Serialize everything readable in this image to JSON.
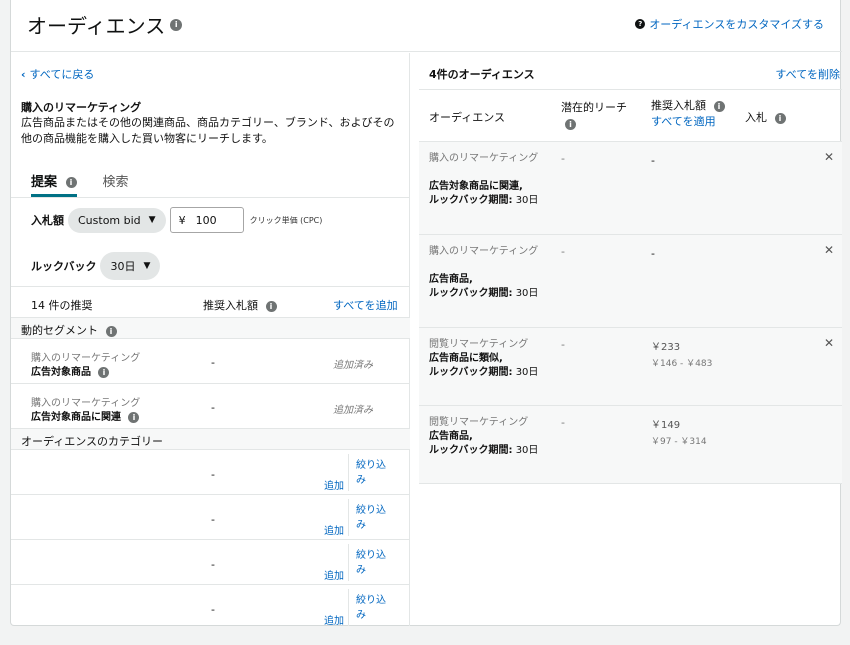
{
  "header": {
    "title": "オーディエンス",
    "customize": "オーディエンスをカスタマイズする"
  },
  "left": {
    "back": "すべてに戻る",
    "desc_title": "購入のリマーケティング",
    "desc_body": "広告商品またはその他の関連商品、商品カテゴリー、ブランド、およびその他の商品機能を購入した買い物客にリーチします。",
    "tabs": [
      {
        "label": "提案"
      },
      {
        "label": "検索"
      }
    ],
    "bid_label": "入札額",
    "bid_type": "Custom bid",
    "currency": "¥",
    "bid_value": "100",
    "cpc_label": "クリック単価 (CPC)",
    "lookback_label": "ルックバック",
    "lookback_value": "30日",
    "suggest_count": "14 件の推奨",
    "rec_bid": "推奨入札額",
    "add_all": "すべてを追加",
    "seg_dynamic": "動的セグメント",
    "rows": [
      {
        "line1": "購入のリマーケティング",
        "line2": "広告対象商品",
        "dash": "-",
        "status": "追加済み"
      },
      {
        "line1": "購入のリマーケティング",
        "line2": "広告対象商品に関連",
        "dash": "-",
        "status": "追加済み"
      }
    ],
    "seg_category": "オーディエンスのカテゴリー",
    "cat_rows": [
      {
        "dash": "-",
        "add": "追加",
        "narrow": "絞り込み"
      },
      {
        "dash": "-",
        "add": "追加",
        "narrow": "絞り込み"
      },
      {
        "dash": "-",
        "add": "追加",
        "narrow": "絞り込み"
      },
      {
        "dash": "-",
        "add": "追加",
        "narrow": "絞り込み"
      }
    ]
  },
  "right": {
    "count": "4件のオーディエンス",
    "delete_all": "すべてを削除",
    "col_audience": "オーディエンス",
    "col_reach": "潜在的リーチ",
    "col_rec_bid": "推奨入札額",
    "col_apply_all": "すべてを適用",
    "col_bid": "入札",
    "items": [
      {
        "name": "購入のリマーケティング",
        "bold": "広告対象商品に関連,",
        "look_label": "ルックバック期間:",
        "look_value": "30日",
        "reach": "-",
        "bid": "-",
        "range": ""
      },
      {
        "name": "購入のリマーケティング",
        "bold": "広告商品,",
        "look_label": "ルックバック期間:",
        "look_value": "30日",
        "reach": "-",
        "bid": "-",
        "range": ""
      },
      {
        "name": "閲覧リマーケティング",
        "bold": "広告商品に類似,",
        "look_label": "ルックバック期間:",
        "look_value": "30日",
        "reach": "-",
        "bid": "￥233",
        "range": "￥146 - ￥483"
      },
      {
        "name": "閲覧リマーケティング",
        "bold": "広告商品,",
        "look_label": "ルックバック期間:",
        "look_value": "30日",
        "reach": "-",
        "bid": "￥149",
        "range": "￥97 - ￥314"
      }
    ]
  }
}
